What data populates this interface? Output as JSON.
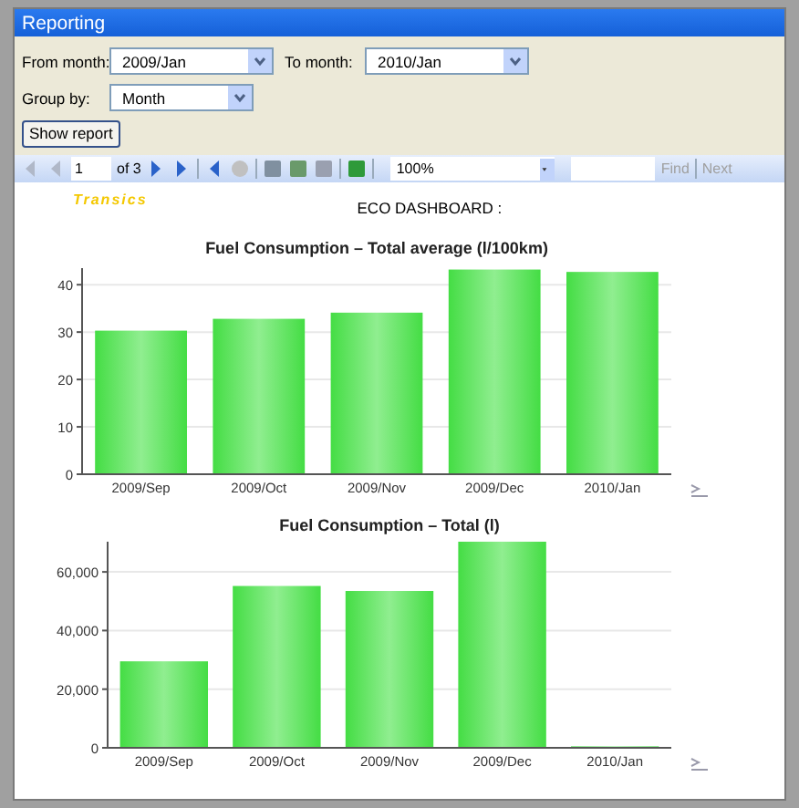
{
  "window": {
    "title": "Reporting"
  },
  "filters": {
    "from_label": "From month:",
    "from_value": "2009/Jan",
    "to_label": "To month:",
    "to_value": "2010/Jan",
    "group_label": "Group by:",
    "group_value": "Month",
    "show_button": "Show report"
  },
  "toolbar": {
    "page": "1",
    "page_count": "of 3",
    "zoom": "100%",
    "find": "Find",
    "next": "Next",
    "find_disabled": true
  },
  "report": {
    "brand": "Transics",
    "title": "ECO DASHBOARD :",
    "charts": [
      {
        "chart_data": {
          "type": "bar",
          "title": "Fuel Consumption – Total average (l/100km)",
          "categories": [
            "2009/Sep",
            "2009/Oct",
            "2009/Nov",
            "2009/Dec",
            "2010/Jan"
          ],
          "series": [
            {
              "color": "#44dd44",
              "values": [
                30.3,
                32.8,
                34.1,
                43.2,
                42.7
              ]
            }
          ],
          "grid": true,
          "ylim": [
            0,
            43.5
          ],
          "yticks": [
            0,
            10,
            20,
            30,
            40
          ]
        }
      },
      {
        "chart_data": {
          "type": "bar",
          "title": "Fuel Consumption – Total (l)",
          "categories": [
            "2009/Sep",
            "2009/Oct",
            "2009/Nov",
            "2009/Dec",
            "2010/Jan"
          ],
          "series": [
            {
              "color": "#44dd44",
              "values": [
                29500,
                55200,
                53500,
                70300,
                500
              ]
            }
          ],
          "grid": true,
          "ylim": [
            0,
            70300
          ],
          "yticks": [
            {
              "value": 0,
              "label": "0"
            },
            {
              "value": 20000,
              "label": "20,000"
            },
            {
              "value": 40000,
              "label": "40,000"
            },
            {
              "value": 60000,
              "label": "60,000"
            }
          ]
        }
      }
    ]
  }
}
